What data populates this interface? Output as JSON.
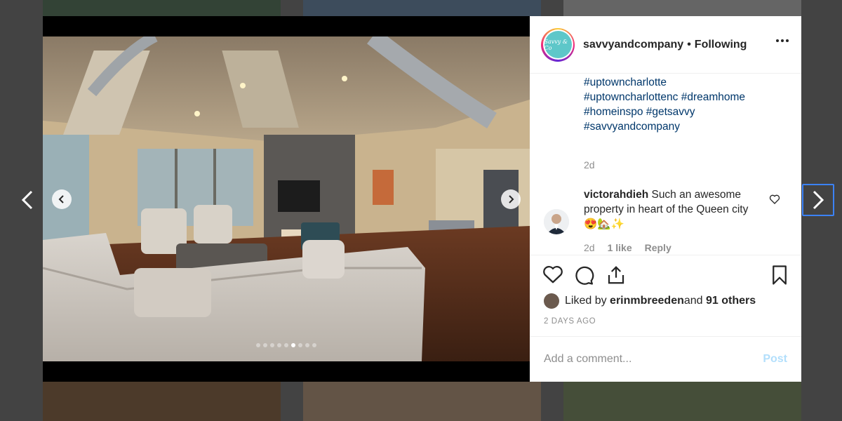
{
  "post": {
    "username": "savvyandcompany",
    "separator": "•",
    "follow_status": "Following",
    "avatar_text": "Savvy & Co",
    "hashtags": [
      "#uptowncharlotte",
      "#uptowncharlottenc #dreamhome",
      "#homeinspo #getsavvy",
      "#savvyandcompany"
    ],
    "caption_time": "2d",
    "comment": {
      "username": "victorahdieh",
      "text": " Such an awesome property in heart of the Queen city 😍🏡✨",
      "time": "2d",
      "likes": "1 like",
      "reply": "Reply"
    },
    "liked_by_prefix": "Liked by ",
    "liked_by_user": "erinmbreeden",
    "liked_by_and": " and ",
    "liked_by_others": "91 others",
    "date": "2 DAYS AGO",
    "comment_placeholder": "Add a comment...",
    "post_label": "Post",
    "carousel": {
      "total": 9,
      "active_index": 5
    }
  },
  "colors": {
    "link": "#00376b",
    "muted": "#8e8e8e",
    "post_disabled": "#b2dffc",
    "brand_teal": "#5ec7c9"
  }
}
